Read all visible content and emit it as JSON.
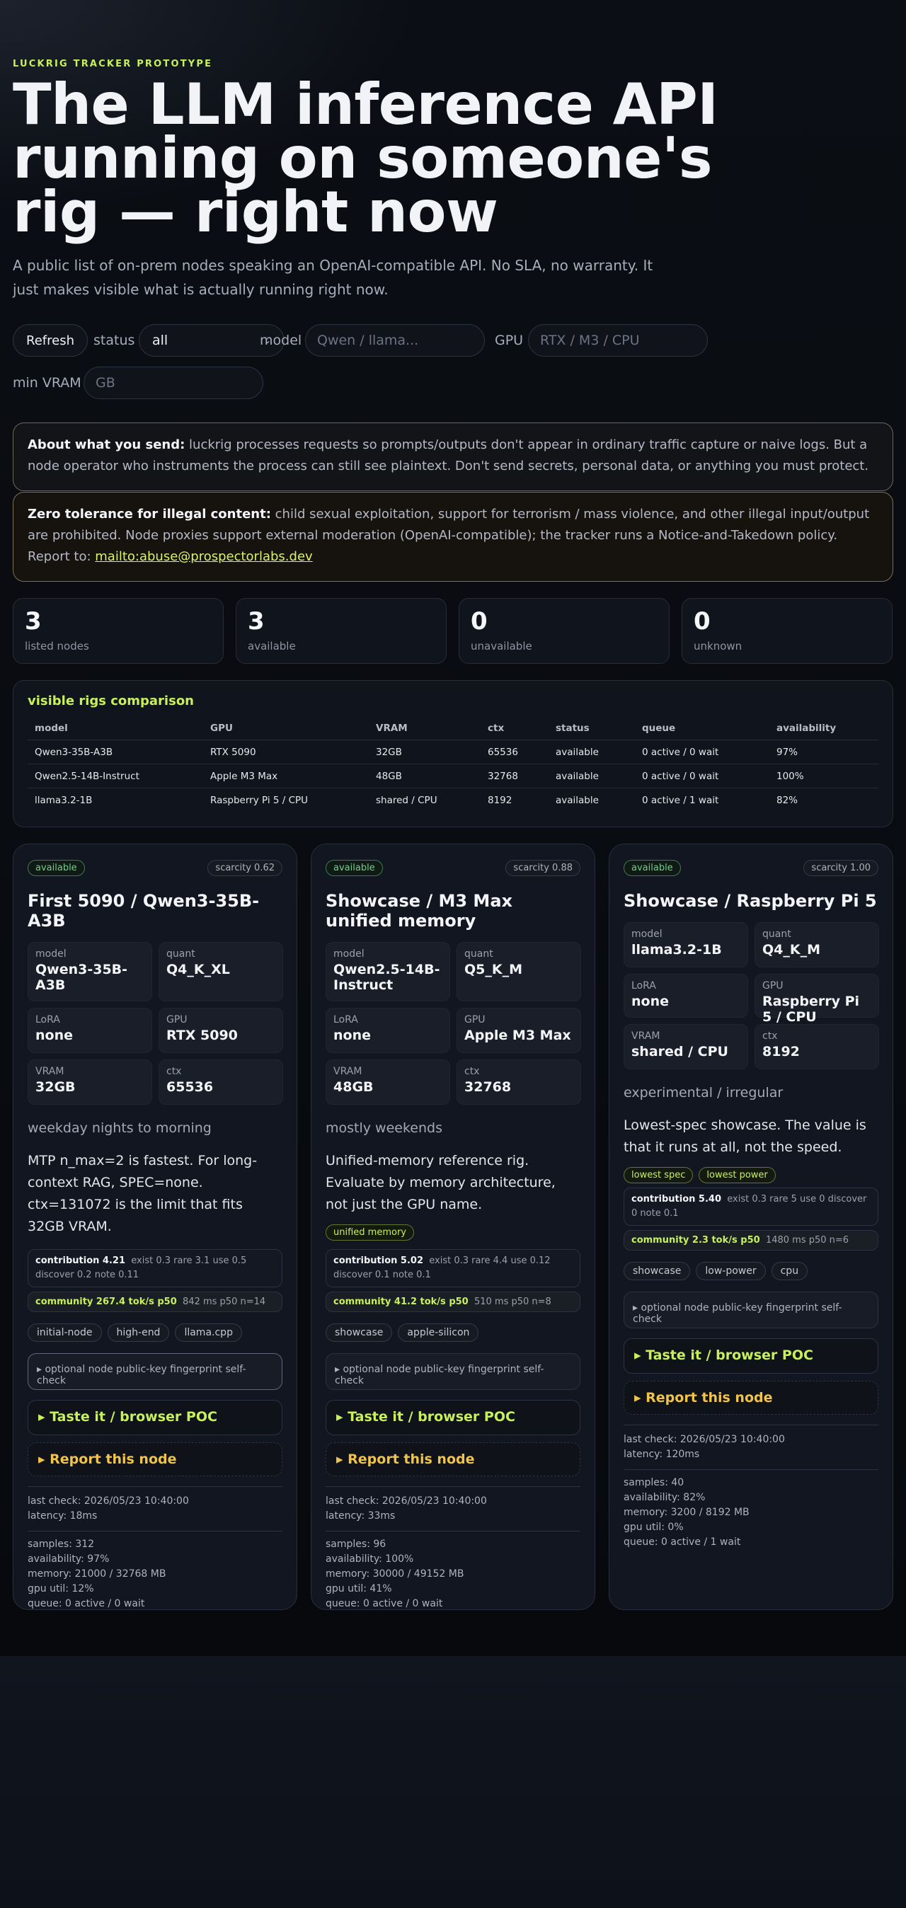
{
  "header": {
    "eyebrow": "LUCKRIG TRACKER PROTOTYPE",
    "title": "The LLM inference API running on someone's rig — right now",
    "lede": "A public list of on-prem nodes speaking an OpenAI-compatible API. No SLA, no warranty. It just makes visible what is actually running right now."
  },
  "controls": {
    "refresh_label": "Refresh",
    "status_label": "status",
    "status_value": "all",
    "model_label": "model",
    "model_placeholder": "Qwen / llama...",
    "gpu_label": "GPU",
    "gpu_placeholder": "RTX / M3 / CPU",
    "vram_label": "min VRAM",
    "vram_placeholder": "GB"
  },
  "notices": {
    "info_title": "About what you send:",
    "info_text": " luckrig processes requests so prompts/outputs don't appear in ordinary traffic capture or naive logs. But a node operator who instruments the process can still see plaintext. Don't send secrets, personal data, or anything you must protect.",
    "warn_title": "Zero tolerance for illegal content:",
    "warn_text": " child sexual exploitation, support for terrorism / mass violence, and other illegal input/output are prohibited. Node proxies support external moderation (OpenAI-compatible); the tracker runs a Notice-and-Takedown policy. Report to: ",
    "warn_link": "mailto:abuse@prospectorlabs.dev"
  },
  "stats": [
    {
      "num": "3",
      "cap": "listed nodes"
    },
    {
      "num": "3",
      "cap": "available"
    },
    {
      "num": "0",
      "cap": "unavailable"
    },
    {
      "num": "0",
      "cap": "unknown"
    }
  ],
  "compare": {
    "title": "visible rigs comparison",
    "headers": [
      "model",
      "GPU",
      "VRAM",
      "ctx",
      "status",
      "queue",
      "availability"
    ],
    "rows": [
      [
        "Qwen3-35B-A3B",
        "RTX 5090",
        "32GB",
        "65536",
        "available",
        "0 active / 0 wait",
        "97%"
      ],
      [
        "Qwen2.5-14B-Instruct",
        "Apple M3 Max",
        "48GB",
        "32768",
        "available",
        "0 active / 0 wait",
        "100%"
      ],
      [
        "llama3.2-1B",
        "Raspberry Pi 5 / CPU",
        "shared / CPU",
        "8192",
        "available",
        "0 active / 1 wait",
        "82%"
      ]
    ]
  },
  "common": {
    "model_k": "model",
    "quant_k": "quant",
    "lora_k": "LoRA",
    "gpu_k": "GPU",
    "vram_k": "VRAM",
    "ctx_k": "ctx",
    "fingerprint": "▸ optional node public-key fingerprint self-check",
    "taste": "▸ Taste it / browser POC",
    "report": "▸ Report this node"
  },
  "cards": [
    {
      "status": "available",
      "scarcity": "scarcity 0.62",
      "title": "First 5090 / Qwen3-35B-A3B",
      "model": "Qwen3-35B-A3B",
      "quant": "Q4_K_XL",
      "lora": "none",
      "gpu": "RTX 5090",
      "vram": "32GB",
      "ctx": "65536",
      "availability": "weekday nights to morning",
      "desc": "MTP n_max=2 is fastest. For long-context RAG, SPEC=none. ctx=131072 is the limit that fits 32GB VRAM.",
      "contrib_title": "contribution 4.21",
      "contrib_detail": "exist 0.3  rare 3.1  use 0.5  discover 0.2  note 0.11",
      "community_title": "community 267.4 tok/s p50",
      "community_detail": "842 ms p50  n=14",
      "chips": [
        "initial-node",
        "high-end",
        "llama.cpp"
      ],
      "last_check": "last check: 2026/05/23 10:40:00",
      "latency": "latency: 18ms",
      "samples": "samples: 312",
      "avail_pct": "availability: 97%",
      "memory": "memory: 21000 / 32768 MB",
      "gpu_util": "gpu util: 12%",
      "queue": "queue: 0 active / 0 wait"
    },
    {
      "status": "available",
      "scarcity": "scarcity 0.88",
      "title": "Showcase / M3 Max unified memory",
      "model": "Qwen2.5-14B-Instruct",
      "quant": "Q5_K_M",
      "lora": "none",
      "gpu": "Apple M3 Max",
      "vram": "48GB",
      "ctx": "32768",
      "availability": "mostly weekends",
      "desc": "Unified-memory reference rig. Evaluate by memory architecture, not just the GPU name.",
      "tags": [
        "unified memory"
      ],
      "contrib_title": "contribution 5.02",
      "contrib_detail": "exist 0.3  rare 4.4  use 0.12  discover 0.1  note 0.1",
      "community_title": "community 41.2 tok/s p50",
      "community_detail": "510 ms p50  n=8",
      "chips": [
        "showcase",
        "apple-silicon"
      ],
      "last_check": "last check: 2026/05/23 10:40:00",
      "latency": "latency: 33ms",
      "samples": "samples: 96",
      "avail_pct": "availability: 100%",
      "memory": "memory: 30000 / 49152 MB",
      "gpu_util": "gpu util: 41%",
      "queue": "queue: 0 active / 0 wait"
    },
    {
      "status": "available",
      "scarcity": "scarcity 1.00",
      "title": "Showcase / Raspberry Pi 5",
      "model": "llama3.2-1B",
      "quant": "Q4_K_M",
      "lora": "none",
      "gpu": "Raspberry Pi 5 / CPU",
      "vram": "shared / CPU",
      "ctx": "8192",
      "availability": "experimental / irregular",
      "desc": "Lowest-spec showcase. The value is that it runs at all, not the speed.",
      "tags": [
        "lowest spec",
        "lowest power"
      ],
      "contrib_title": "contribution 5.40",
      "contrib_detail": "exist 0.3  rare 5  use 0  discover 0  note 0.1",
      "community_title": "community 2.3 tok/s p50",
      "community_detail": "1480 ms p50  n=6",
      "chips": [
        "showcase",
        "low-power",
        "cpu"
      ],
      "last_check": "last check: 2026/05/23 10:40:00",
      "latency": "latency: 120ms",
      "samples": "samples: 40",
      "avail_pct": "availability: 82%",
      "memory": "memory: 3200 / 8192 MB",
      "gpu_util": "gpu util: 0%",
      "queue": "queue: 0 active / 1 wait"
    }
  ],
  "colors": {
    "accent": "#c7f05a",
    "ok": "#6fd08a",
    "warn": "#f0c44a"
  }
}
